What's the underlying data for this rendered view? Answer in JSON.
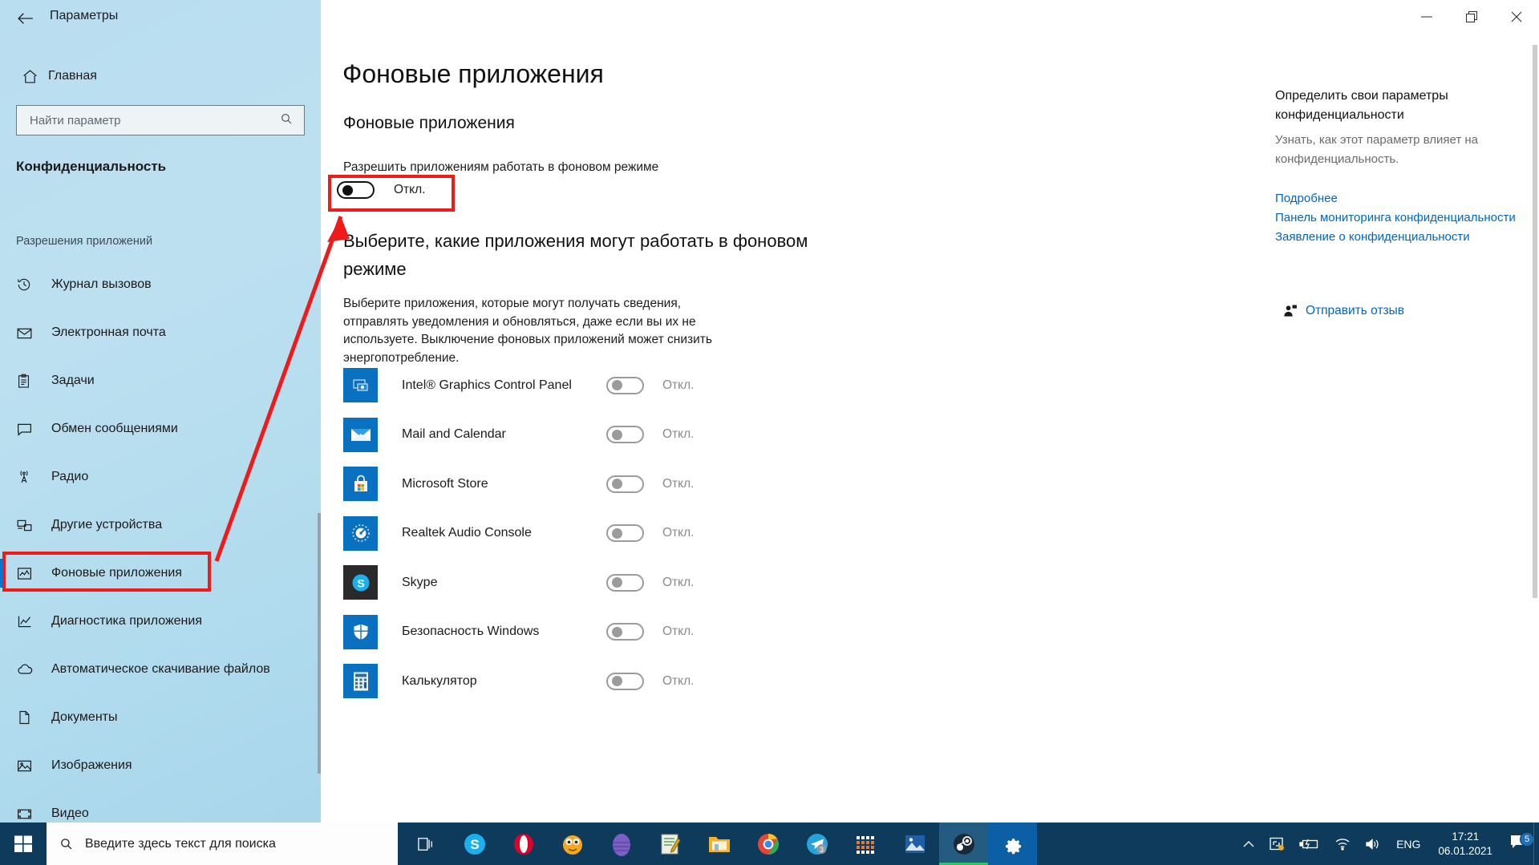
{
  "window": {
    "title": "Параметры",
    "back_icon": "back-arrow-icon",
    "minimize_icon": "minimize-icon",
    "maximize_icon": "maximize-icon",
    "close_icon": "close-icon"
  },
  "sidebar": {
    "home_label": "Главная",
    "home_icon": "home-icon",
    "search": {
      "placeholder": "Найти параметр",
      "icon": "search-icon"
    },
    "category": "Конфиденциальность",
    "group_label": "Разрешения приложений",
    "items": [
      {
        "label": "Журнал вызовов",
        "icon": "call-history-icon",
        "selected": false
      },
      {
        "label": "Электронная почта",
        "icon": "mail-icon",
        "selected": false
      },
      {
        "label": "Задачи",
        "icon": "tasks-icon",
        "selected": false
      },
      {
        "label": "Обмен сообщениями",
        "icon": "messaging-icon",
        "selected": false
      },
      {
        "label": "Радио",
        "icon": "radio-icon",
        "selected": false
      },
      {
        "label": "Другие устройства",
        "icon": "other-devices-icon",
        "selected": false
      },
      {
        "label": "Фоновые приложения",
        "icon": "background-apps-icon",
        "selected": true
      },
      {
        "label": "Диагностика приложения",
        "icon": "app-diagnostics-icon",
        "selected": false
      },
      {
        "label": "Автоматическое скачивание файлов",
        "icon": "cloud-download-icon",
        "selected": false
      },
      {
        "label": "Документы",
        "icon": "document-icon",
        "selected": false
      },
      {
        "label": "Изображения",
        "icon": "pictures-icon",
        "selected": false
      },
      {
        "label": "Видео",
        "icon": "video-icon",
        "selected": false
      }
    ]
  },
  "main": {
    "page_title": "Фоновые приложения",
    "section_heading": "Фоновые приложения",
    "allow_label": "Разрешить приложениям работать в фоновом режиме",
    "master_toggle_state": "Откл.",
    "choose_heading": "Выберите, какие приложения могут работать в фоновом режиме",
    "description": "Выберите приложения, которые могут получать сведения, отправлять уведомления и обновляться, даже если вы их не используете. Выключение фоновых приложений может снизить энергопотребление.",
    "apps": [
      {
        "name": "Intel® Graphics Control Panel",
        "icon": "intel-graphics-icon",
        "state": "Откл."
      },
      {
        "name": "Mail and Calendar",
        "icon": "mail-app-icon",
        "state": "Откл."
      },
      {
        "name": "Microsoft Store",
        "icon": "microsoft-store-icon",
        "state": "Откл."
      },
      {
        "name": "Realtek Audio Console",
        "icon": "realtek-audio-icon",
        "state": "Откл."
      },
      {
        "name": "Skype",
        "icon": "skype-icon",
        "state": "Откл."
      },
      {
        "name": "Безопасность Windows",
        "icon": "windows-security-icon",
        "state": "Откл."
      },
      {
        "name": "Калькулятор",
        "icon": "calculator-icon",
        "state": "Откл."
      }
    ]
  },
  "right_panel": {
    "heading": "Определить свои параметры конфиденциальности",
    "paragraph": "Узнать, как этот параметр влияет на конфиденциальность.",
    "links": [
      "Подробнее",
      "Панель мониторинга конфиденциальности",
      "Заявление о конфиденциальности"
    ],
    "feedback_label": "Отправить отзыв",
    "feedback_icon": "feedback-person-icon"
  },
  "taskbar": {
    "start_icon": "windows-start-icon",
    "search_placeholder": "Введите здесь текст для поиска",
    "search_icon": "search-icon",
    "apps": [
      {
        "icon": "task-view-icon",
        "active": false
      },
      {
        "icon": "skype-icon",
        "active": false
      },
      {
        "icon": "opera-icon",
        "active": false
      },
      {
        "icon": "emoji-app-icon",
        "active": false
      },
      {
        "icon": "purple-egg-icon",
        "active": false
      },
      {
        "icon": "notepad-app-icon",
        "active": false
      },
      {
        "icon": "file-explorer-icon",
        "active": false
      },
      {
        "icon": "chrome-icon",
        "active": false
      },
      {
        "icon": "telegram-icon",
        "active": false,
        "badge": "3"
      },
      {
        "icon": "grid-app-icon",
        "active": false
      },
      {
        "icon": "photos-icon",
        "active": false
      },
      {
        "icon": "steam-icon",
        "active": true
      },
      {
        "icon": "settings-gear-icon",
        "active": false
      }
    ],
    "tray": {
      "chevron_icon": "chevron-up-icon",
      "onedrive_icon": "onedrive-sync-icon",
      "battery_icon": "battery-charging-icon",
      "wifi_icon": "wifi-icon",
      "volume_icon": "volume-icon",
      "language": "ENG",
      "time": "17:21",
      "date": "06.01.2021",
      "action_center_icon": "action-center-icon",
      "notification_count": "5"
    }
  },
  "annotations": {
    "highlight_nav_item": "Фоновые приложения",
    "highlight_toggle": "Разрешить приложениям работать в фоновом режиме",
    "accent_color": "#ee1b1b"
  }
}
